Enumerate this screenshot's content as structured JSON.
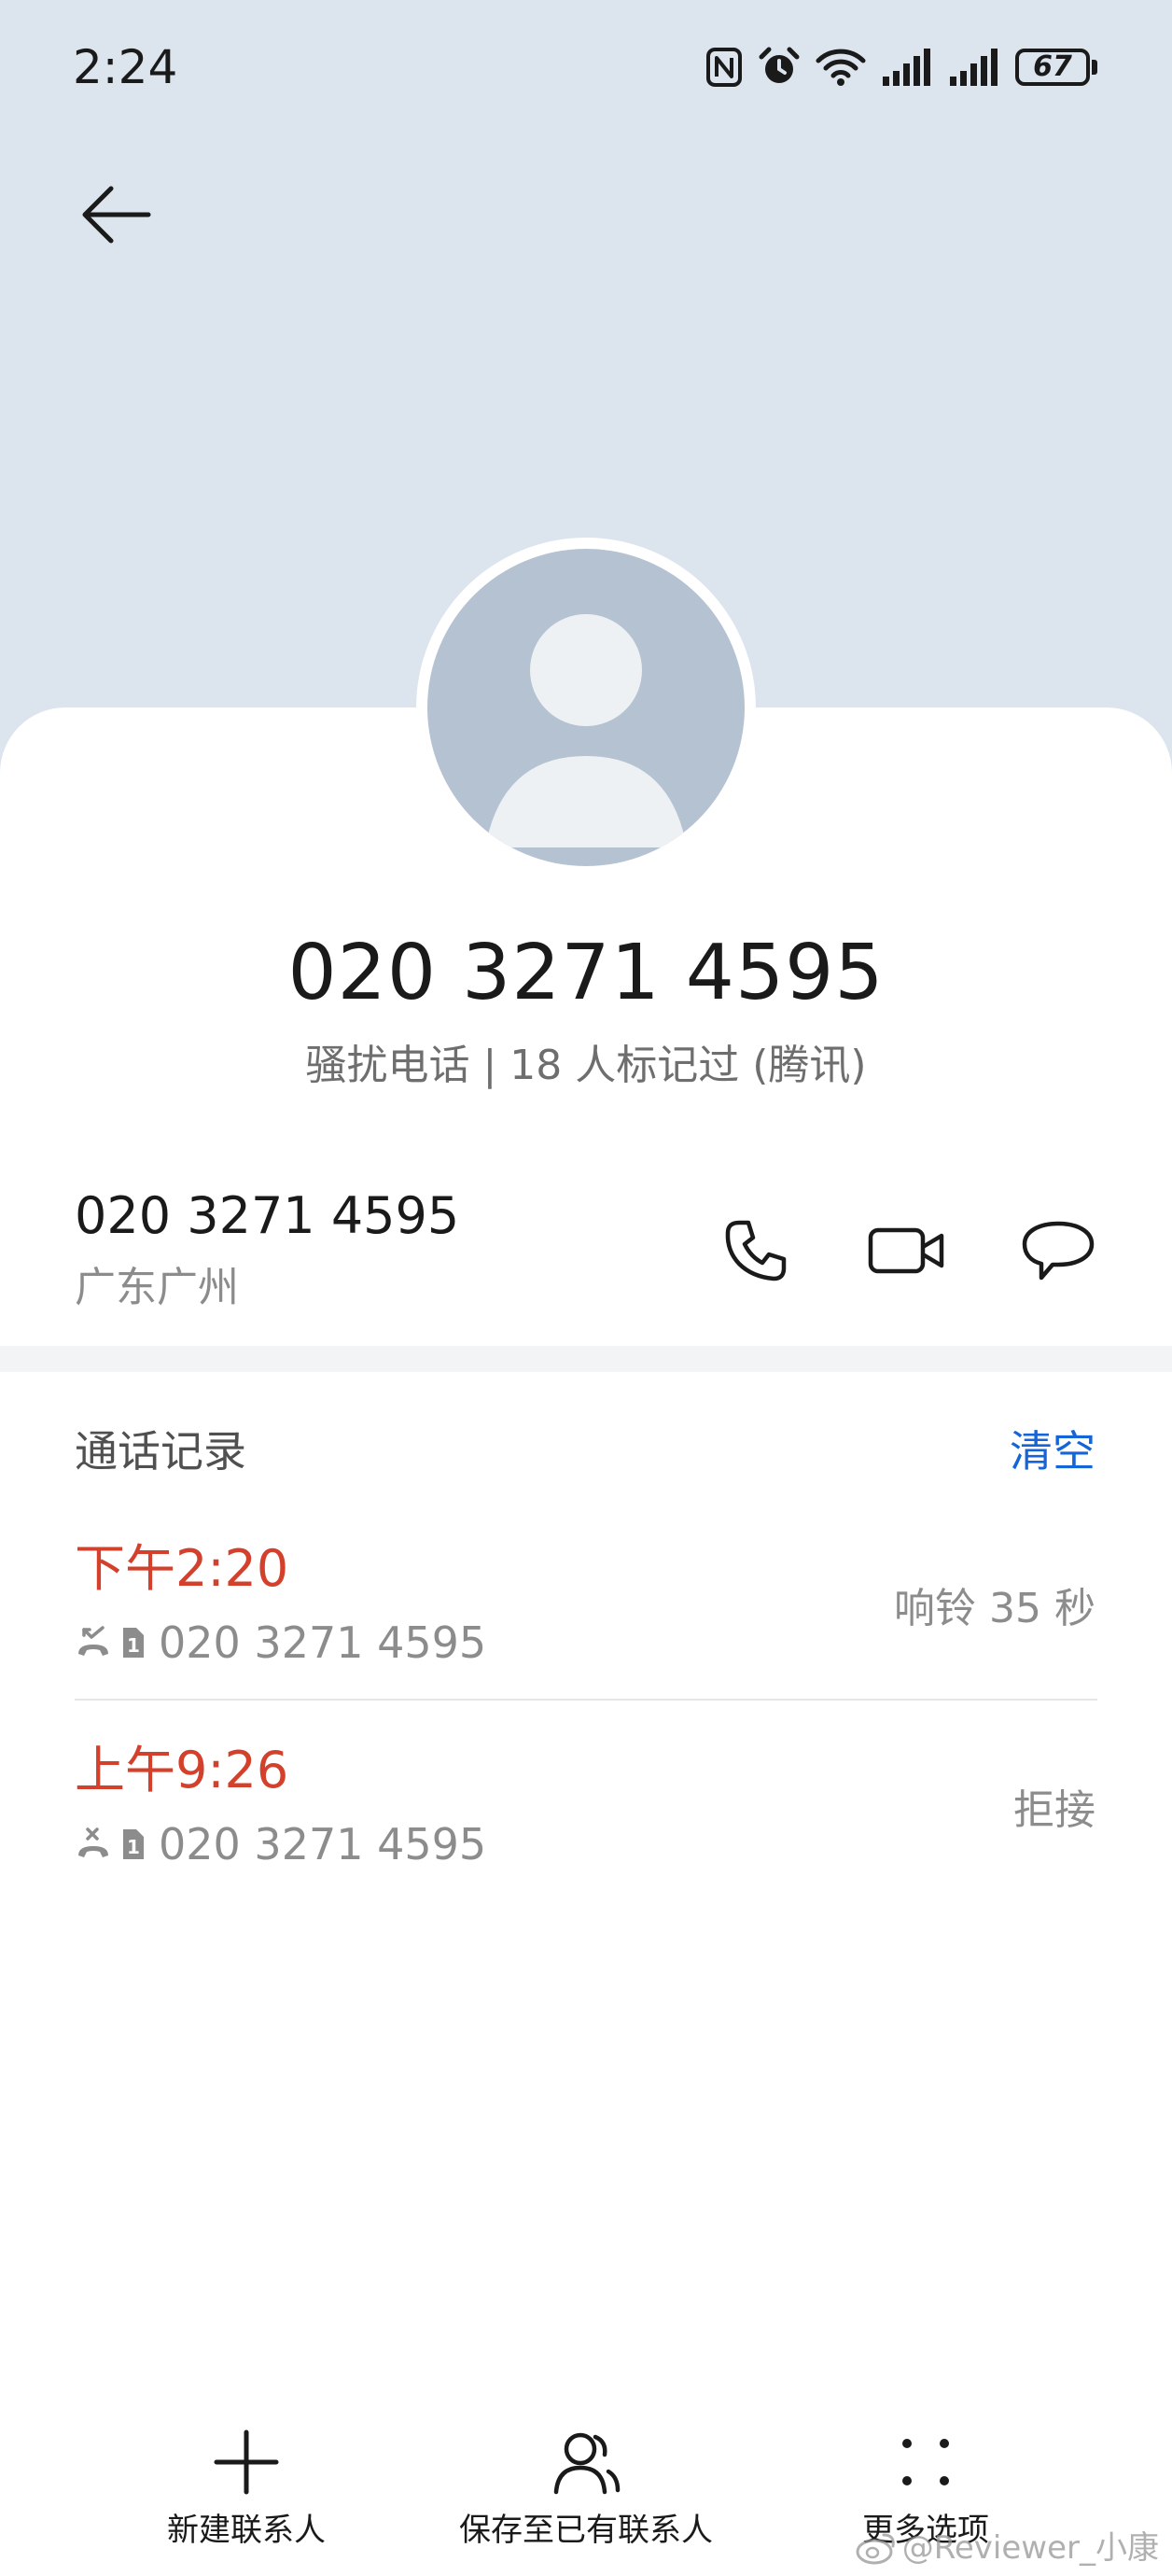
{
  "status_bar": {
    "time": "2:24",
    "battery": "67"
  },
  "header": {
    "phone_number": "020 3271 4595",
    "tag": "骚扰电话 | 18 人标记过 (腾讯)"
  },
  "number_row": {
    "number": "020 3271 4595",
    "location": "广东广州"
  },
  "call_log": {
    "title": "通话记录",
    "clear_label": "清空",
    "items": [
      {
        "time": "下午2:20",
        "number": "020 3271 4595",
        "status": "响铃 35 秒",
        "sim": "1"
      },
      {
        "time": "上午9:26",
        "number": "020 3271 4595",
        "status": "拒接",
        "sim": "1"
      }
    ]
  },
  "bottom_bar": {
    "new_contact": "新建联系人",
    "save_existing": "保存至已有联系人",
    "more_options": "更多选项"
  },
  "watermark": "@Reviewer_小康",
  "colors": {
    "accent": "#1565d8",
    "missed": "#d3402b",
    "header_bg": "#dce4ee",
    "avatar_bg": "#b5c2d2"
  }
}
